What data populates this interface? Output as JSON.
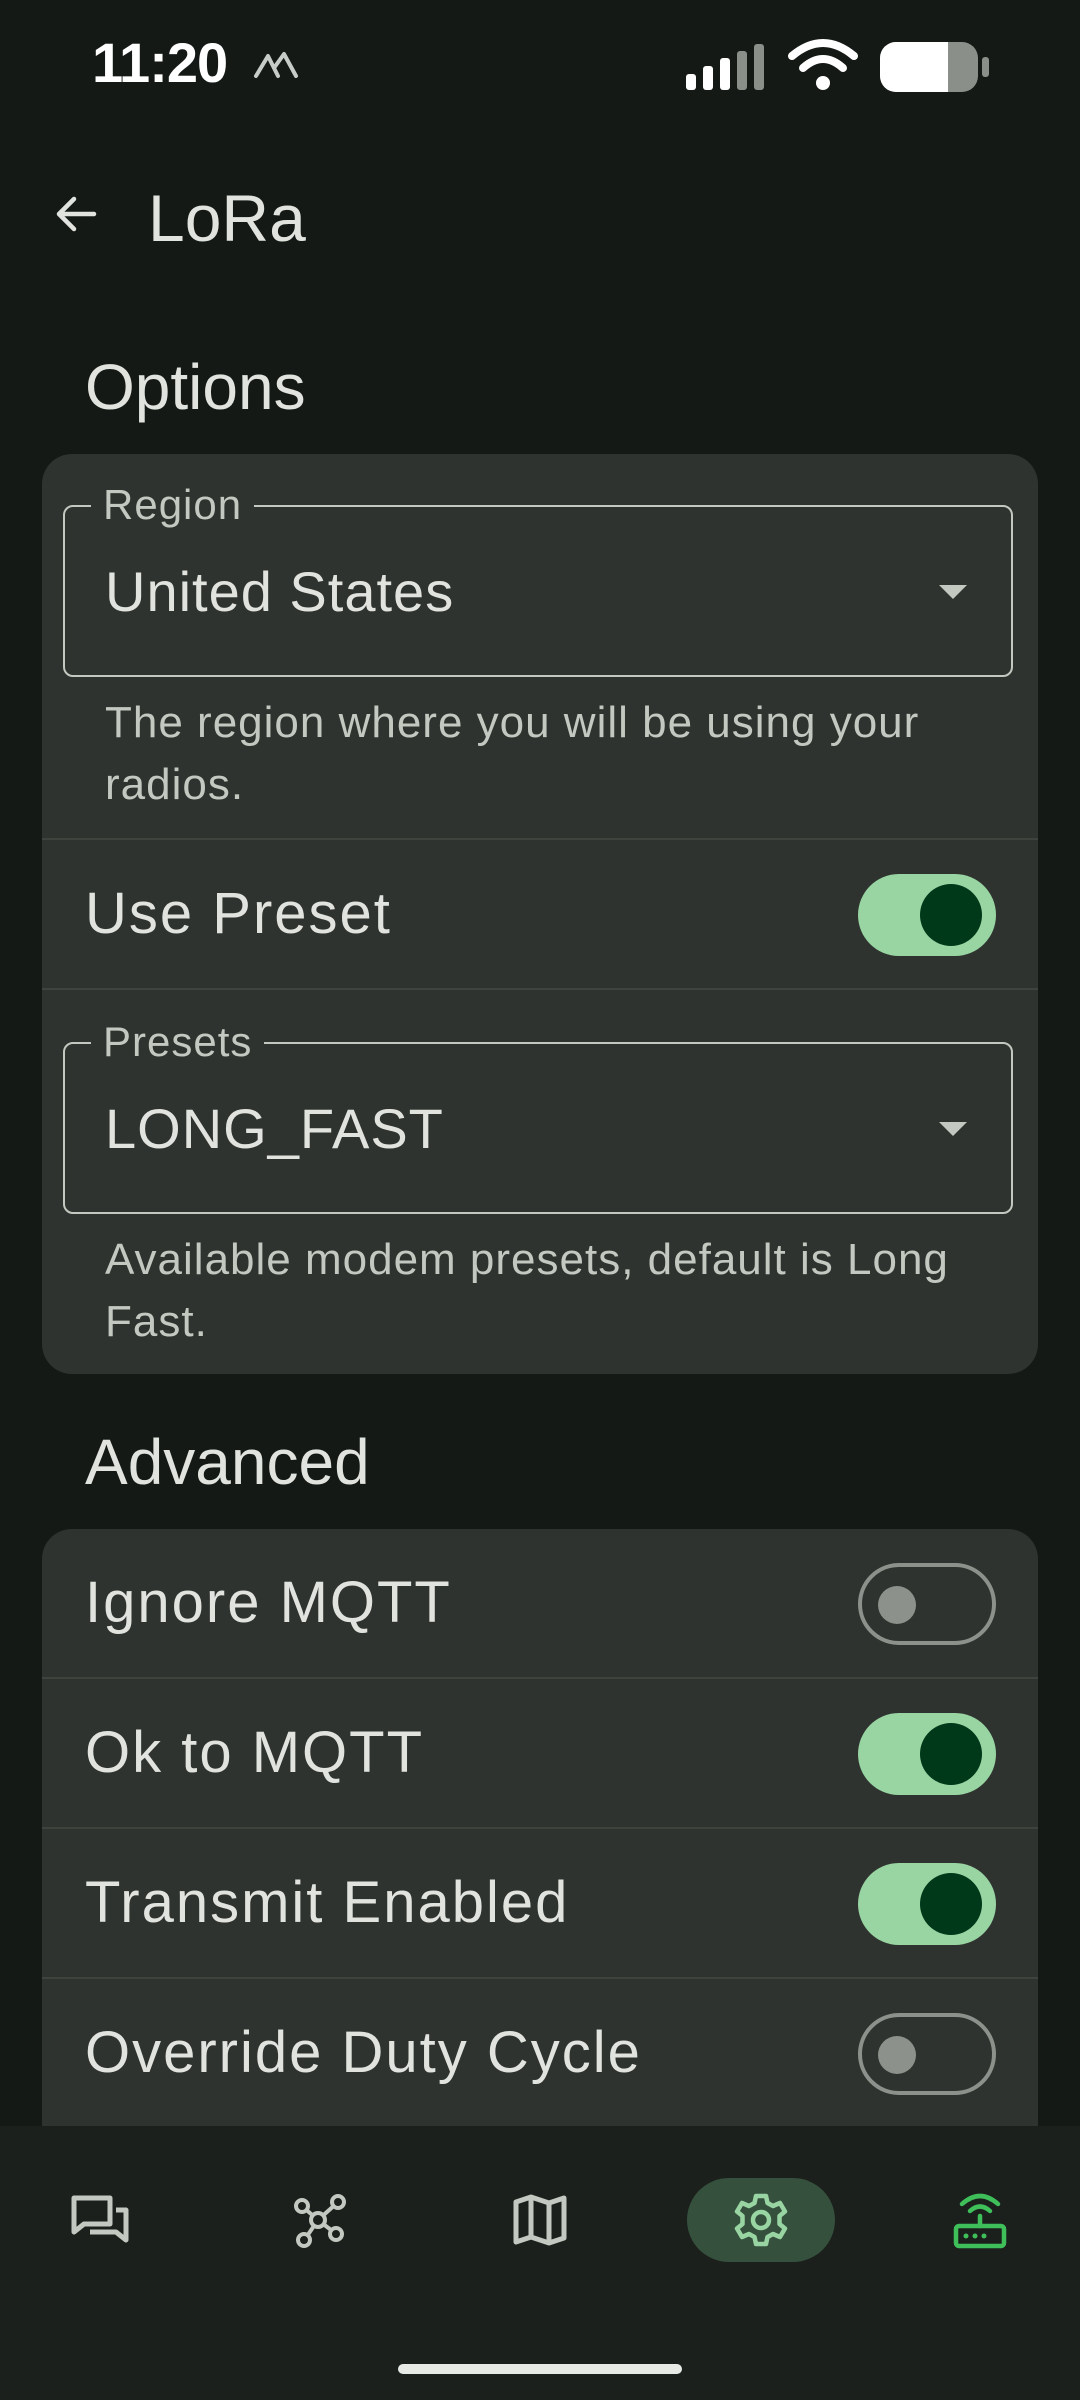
{
  "status_bar": {
    "time": "11:20"
  },
  "top_bar": {
    "title": "LoRa"
  },
  "options": {
    "header": "Options",
    "region": {
      "label": "Region",
      "value": "United States",
      "helper": "The region where you will be using your radios."
    },
    "use_preset": {
      "label": "Use Preset",
      "checked": true
    },
    "presets": {
      "label": "Presets",
      "value": "LONG_FAST",
      "helper": "Available modem presets, default is Long Fast."
    }
  },
  "advanced": {
    "header": "Advanced",
    "switches": [
      {
        "label": "Ignore MQTT",
        "checked": false
      },
      {
        "label": "Ok to MQTT",
        "checked": true
      },
      {
        "label": "Transmit Enabled",
        "checked": true
      },
      {
        "label": "Override Duty Cycle",
        "checked": false
      }
    ]
  },
  "bottom_nav": {
    "items": [
      {
        "icon": "messages-icon",
        "active": false
      },
      {
        "icon": "nodes-icon",
        "active": false
      },
      {
        "icon": "map-icon",
        "active": false
      },
      {
        "icon": "settings-icon",
        "active": true
      },
      {
        "icon": "router-icon",
        "active": false
      }
    ]
  },
  "colors": {
    "background": "#141915",
    "card": "#2F332F",
    "switch_on_track": "#98D5A2",
    "switch_on_thumb": "#00391A",
    "nav_active_pill": "#35503C",
    "router_icon": "#3FBF5A"
  }
}
